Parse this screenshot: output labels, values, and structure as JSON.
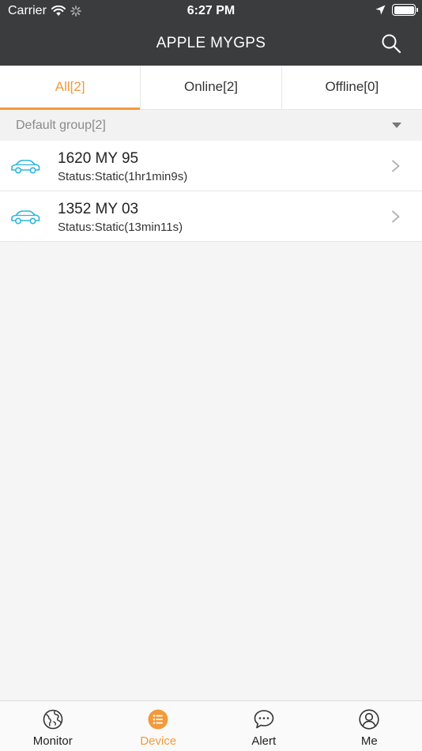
{
  "status_bar": {
    "carrier": "Carrier",
    "time": "6:27 PM"
  },
  "header": {
    "title": "APPLE MYGPS"
  },
  "tabs": [
    {
      "label": "All[2]",
      "active": true
    },
    {
      "label": "Online[2]",
      "active": false
    },
    {
      "label": "Offline[0]",
      "active": false
    }
  ],
  "group": {
    "label": "Default group[2]"
  },
  "devices": [
    {
      "name": "1620 MY 95",
      "status": "Status:Static(1hr1min9s)"
    },
    {
      "name": "1352 MY 03",
      "status": "Status:Static(13min11s)"
    }
  ],
  "bottom_nav": [
    {
      "label": "Monitor",
      "icon": "globe-icon",
      "active": false
    },
    {
      "label": "Device",
      "icon": "list-icon",
      "active": true
    },
    {
      "label": "Alert",
      "icon": "chat-bubble-icon",
      "active": false
    },
    {
      "label": "Me",
      "icon": "user-icon",
      "active": false
    }
  ],
  "colors": {
    "accent": "#f39a3a",
    "header_bg": "#3b3c3e",
    "car_icon": "#2bb5e0"
  }
}
